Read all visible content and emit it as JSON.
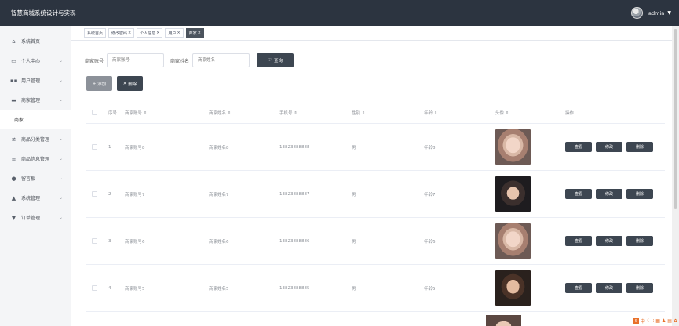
{
  "header": {
    "title": "智慧商城系统设计与实现",
    "user": "admin"
  },
  "sidebar": {
    "items": [
      {
        "label": "系统首页",
        "icon": "home-icon",
        "glyph": "⌂",
        "has_arrow": false
      },
      {
        "label": "个人中心",
        "icon": "calendar-icon",
        "glyph": "▭",
        "has_arrow": true
      },
      {
        "label": "用户管理",
        "icon": "grid-icon",
        "glyph": "▪▪",
        "has_arrow": true
      },
      {
        "label": "商家管理",
        "icon": "briefcase-icon",
        "glyph": "▬",
        "has_arrow": true
      },
      {
        "label": "商家",
        "submenu": true
      },
      {
        "label": "商品分类管理",
        "icon": "sliders-icon",
        "glyph": "≢",
        "has_arrow": true
      },
      {
        "label": "商品信息管理",
        "icon": "list-icon",
        "glyph": "≡",
        "has_arrow": true
      },
      {
        "label": "留言板",
        "icon": "location-icon",
        "glyph": "●",
        "has_arrow": true
      },
      {
        "label": "系统管理",
        "icon": "person-icon",
        "glyph": "▲",
        "has_arrow": true
      },
      {
        "label": "订单管理",
        "icon": "shield-icon",
        "glyph": "▼",
        "has_arrow": true
      }
    ]
  },
  "tags": [
    {
      "label": "系统首页",
      "closable": false,
      "active": false
    },
    {
      "label": "修改密码",
      "closable": true,
      "active": false
    },
    {
      "label": "个人信息",
      "closable": true,
      "active": false
    },
    {
      "label": "用户",
      "closable": true,
      "active": false
    },
    {
      "label": "商家",
      "closable": true,
      "active": true
    }
  ],
  "search": {
    "account_label": "商家账号",
    "account_placeholder": "商家账号",
    "name_label": "商家姓名",
    "name_placeholder": "商家姓名",
    "button": "查询"
  },
  "actions": {
    "add": "添加",
    "delete": "删除"
  },
  "table": {
    "headers": [
      "序号",
      "商家账号 ⇕",
      "商家姓名 ⇕",
      "手机号 ⇕",
      "性别 ⇕",
      "年龄 ⇕",
      "头像 ⇕",
      "操作"
    ],
    "rows": [
      {
        "index": "1",
        "account": "商家账号8",
        "name": "商家姓名8",
        "phone": "13823888888",
        "sex": "男",
        "age": "年龄8",
        "photo": "f"
      },
      {
        "index": "2",
        "account": "商家账号7",
        "name": "商家姓名7",
        "phone": "13823888887",
        "sex": "男",
        "age": "年龄7",
        "photo": "m1"
      },
      {
        "index": "3",
        "account": "商家账号6",
        "name": "商家姓名6",
        "phone": "13823888886",
        "sex": "男",
        "age": "年龄6",
        "photo": "f"
      },
      {
        "index": "4",
        "account": "商家账号5",
        "name": "商家姓名5",
        "phone": "13823888885",
        "sex": "男",
        "age": "年龄5",
        "photo": "m2"
      }
    ],
    "row_actions": [
      "查看",
      "修改",
      "删除"
    ]
  },
  "colors": {
    "header_bg": "#2c3440",
    "button_dark": "#3d4651",
    "active_tag": "#4b535d"
  }
}
